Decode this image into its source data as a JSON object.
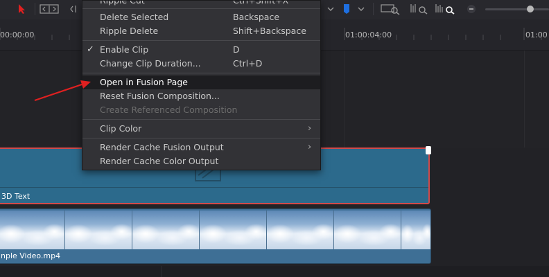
{
  "timeline": {
    "timecodes": [
      "00:00:00",
      "01:00:04:00",
      "01:00"
    ]
  },
  "clips": {
    "title_clip_label": "3D Text",
    "video_clip_label": "nple Video.mp4"
  },
  "menu": {
    "items": [
      {
        "label": "Ripple Cut",
        "shortcut": "Ctrl+Shift+X"
      },
      {
        "label": "Delete Selected",
        "shortcut": "Backspace"
      },
      {
        "label": "Ripple Delete",
        "shortcut": "Shift+Backspace"
      },
      {
        "label": "Enable Clip",
        "shortcut": "D",
        "checked": true
      },
      {
        "label": "Change Clip Duration...",
        "shortcut": "Ctrl+D"
      },
      {
        "label": "Open in Fusion Page",
        "highlighted": true
      },
      {
        "label": "Reset Fusion Composition..."
      },
      {
        "label": "Create Referenced Composition",
        "disabled": true
      },
      {
        "label": "Clip Color",
        "submenu": true
      },
      {
        "label": "Render Cache Fusion Output",
        "submenu": true
      },
      {
        "label": "Render Cache Color Output"
      }
    ]
  },
  "colors": {
    "accent_red": "#e02020",
    "flag_blue": "#1e6fe0",
    "title_clip": "#2c6a8c",
    "video_clip": "#3e6f95",
    "selection_border": "#d14a4a"
  },
  "icons": [
    "pointer-icon",
    "trim-icon",
    "blade-icon",
    "flag-icon",
    "zoom-full-icon",
    "zoom-detail-icon",
    "zoom-custom-icon",
    "minus-icon",
    "zoom-slider"
  ]
}
